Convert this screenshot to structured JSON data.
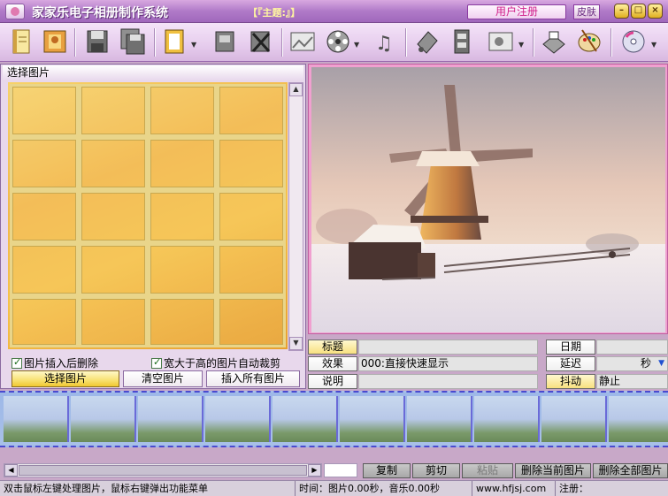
{
  "window": {
    "title": "家家乐电子相册制作系统",
    "theme_label": "【『主题:』】",
    "register_label": "用户注册",
    "skin_label": "皮肤"
  },
  "toolbar": {
    "icons": [
      "notebook-icon",
      "photo-album-icon",
      "save-icon",
      "save-as-icon",
      "frame-icon",
      "disk-add-icon",
      "disk-delete-icon",
      "edit-image-icon",
      "film-reel-icon",
      "music-notes-icon",
      "stamp-icon",
      "film-settings-icon",
      "projector-icon",
      "printer-icon",
      "paint-palette-icon",
      "cd-burn-icon"
    ]
  },
  "left_panel": {
    "title": "选择图片",
    "checkbox_delete_after_insert": "图片插入后删除",
    "checkbox_auto_crop": "宽大于高的图片自动裁剪",
    "btn_select": "选择图片",
    "btn_clear": "清空图片",
    "btn_insert_all": "插入所有图片"
  },
  "info": {
    "title_label": "标题",
    "title_value": "",
    "effect_label": "效果",
    "effect_value": "000:直接快速显示",
    "desc_label": "说明",
    "desc_value": "",
    "date_label": "日期",
    "date_value": "",
    "delay_label": "延迟",
    "delay_unit": "秒",
    "shake_label": "抖动",
    "shake_value": "静止"
  },
  "bottom": {
    "copy": "复制",
    "cut": "剪切",
    "paste": "粘贴",
    "delete_current": "删除当前图片",
    "delete_all": "删除全部图片"
  },
  "status": {
    "hint": "双击鼠标左键处理图片，鼠标右键弹出功能菜单",
    "time": "时间：图片0.00秒，音乐0.00秒",
    "website": "www.hfjsj.com",
    "register": "注册："
  },
  "colors": {
    "titlebar": "#b07ac8",
    "accent_pink": "#d0208a",
    "grid_gold": "#f2b84a"
  }
}
